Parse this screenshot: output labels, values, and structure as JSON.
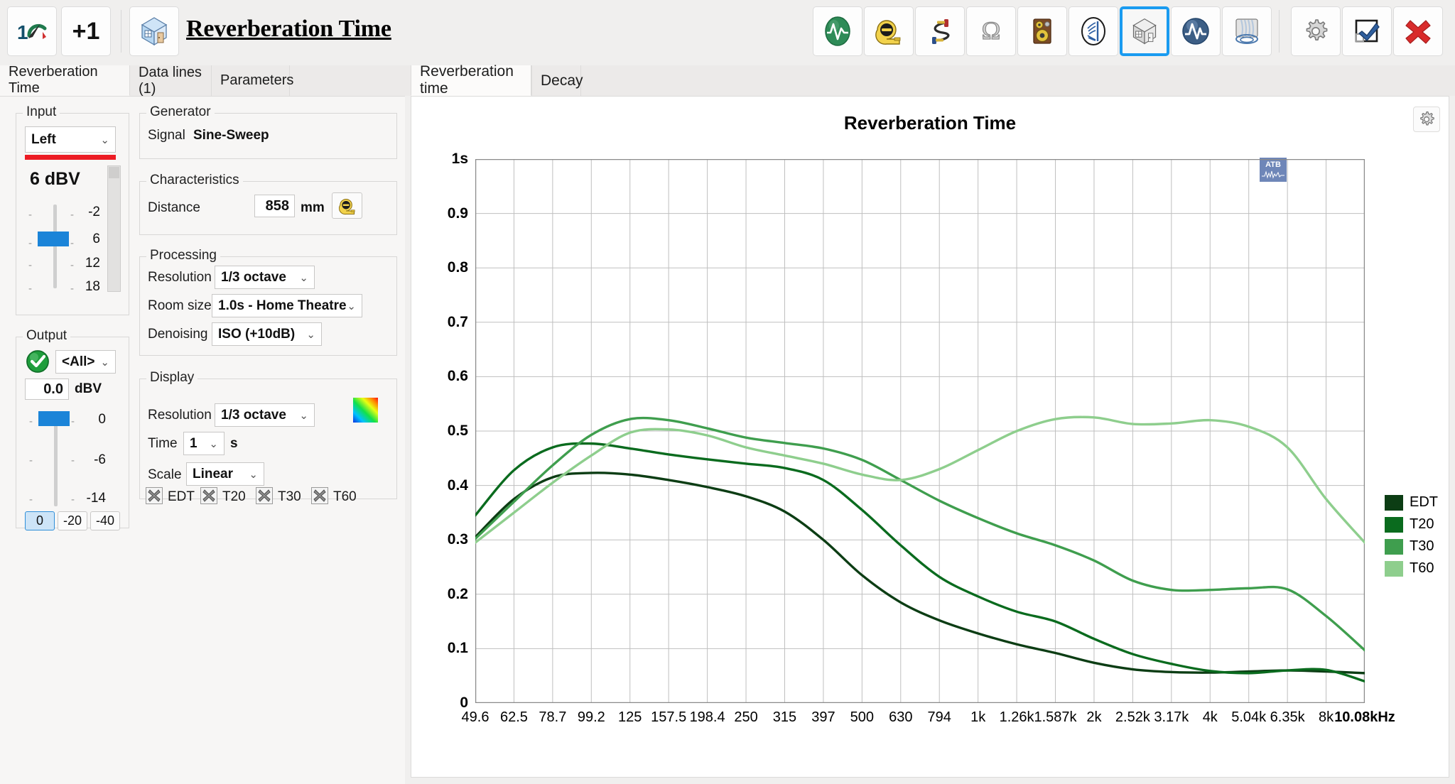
{
  "toolbar": {
    "left_buttons": [
      {
        "name": "gauge-one-button",
        "label": "1",
        "icon": "gauge-icon"
      },
      {
        "name": "plus-one-button",
        "label": "+1",
        "icon": "plus-one-icon"
      },
      {
        "name": "room-button",
        "label": "",
        "icon": "room-cube-icon"
      }
    ],
    "title": "Reverberation Time",
    "right_buttons": [
      {
        "name": "signal-button",
        "icon": "green-waveform-icon",
        "selected": false
      },
      {
        "name": "distance-button",
        "icon": "tape-measure-icon",
        "selected": false
      },
      {
        "name": "cable-button",
        "icon": "cable-icon",
        "selected": false
      },
      {
        "name": "impedance-button",
        "icon": "omega-icon",
        "selected": false
      },
      {
        "name": "speaker-button",
        "icon": "loudspeaker-icon",
        "selected": false
      },
      {
        "name": "microphone-button",
        "icon": "mic-pattern-icon",
        "selected": false
      },
      {
        "name": "room-acoustics-button",
        "icon": "room-cube-icon",
        "selected": true
      },
      {
        "name": "impulse-button",
        "icon": "blue-waveform-icon",
        "selected": false
      },
      {
        "name": "waterfall-button",
        "icon": "waterfall-icon",
        "selected": false
      },
      {
        "name": "settings-button",
        "icon": "gear-icon",
        "selected": false
      },
      {
        "name": "report-button",
        "icon": "report-check-icon",
        "selected": false
      },
      {
        "name": "close-button",
        "icon": "red-x-icon",
        "selected": false
      }
    ]
  },
  "left_panel": {
    "tabs": [
      {
        "label": "Reverberation Time",
        "active": true
      },
      {
        "label": "Data lines (1)",
        "active": false
      },
      {
        "label": "Parameters",
        "active": false
      }
    ],
    "input": {
      "title": "Input",
      "channel": "Left",
      "level_value": "6 dBV",
      "scale": [
        "-2",
        "6",
        "12",
        "18"
      ]
    },
    "output": {
      "title": "Output",
      "device": "<All>",
      "gain_value": "0.0",
      "gain_unit": "dBV",
      "scale": [
        "0",
        "-6",
        "-14"
      ],
      "presets": [
        {
          "label": "0",
          "active": true
        },
        {
          "label": "-20",
          "active": false
        },
        {
          "label": "-40",
          "active": false
        }
      ]
    },
    "generator": {
      "title": "Generator",
      "signal_label": "Signal",
      "signal_value": "Sine-Sweep"
    },
    "characteristics": {
      "title": "Characteristics",
      "distance_label": "Distance",
      "distance_value": "858",
      "distance_unit": "mm",
      "measure_button_icon": "tape-measure-icon"
    },
    "processing": {
      "title": "Processing",
      "resolution_label": "Resolution",
      "resolution_value": "1/3 octave",
      "roomsize_label": "Room size",
      "roomsize_value": "1.0s - Home Theatre",
      "denoising_label": "Denoising",
      "denoising_value": "ISO (+10dB)"
    },
    "display": {
      "title": "Display",
      "resolution_label": "Resolution",
      "resolution_value": "1/3 octave",
      "time_label": "Time",
      "time_value": "1",
      "time_unit": "s",
      "scale_label": "Scale",
      "scale_value": "Linear",
      "color_swatch_icon": "rainbow-gradient-icon",
      "curves": [
        {
          "label": "EDT",
          "checked": true
        },
        {
          "label": "T20",
          "checked": true
        },
        {
          "label": "T30",
          "checked": true
        },
        {
          "label": "T60",
          "checked": true
        }
      ]
    }
  },
  "right_panel": {
    "tabs": [
      {
        "label": "Reverberation time",
        "active": true
      },
      {
        "label": "Decay",
        "active": false
      }
    ],
    "gear_icon": "gear-icon",
    "watermark": "ATB"
  },
  "chart_data": {
    "type": "line",
    "title": "Reverberation Time",
    "xlabel": "",
    "ylabel": "1s",
    "ylim": [
      0,
      1
    ],
    "yticks": [
      "0",
      "0.1",
      "0.2",
      "0.3",
      "0.4",
      "0.5",
      "0.6",
      "0.7",
      "0.8",
      "0.9",
      "1s"
    ],
    "grid": true,
    "legend_position": "right",
    "x_unit_label": "10.08kHz",
    "categories": [
      "49.6",
      "62.5",
      "78.7",
      "99.2",
      "125",
      "157.5",
      "198.4",
      "250",
      "315",
      "397",
      "500",
      "630",
      "794",
      "1k",
      "1.26k",
      "1.587k",
      "2k",
      "2.52k",
      "3.17k",
      "4k",
      "5.04k",
      "6.35k",
      "8k",
      "10.08kHz"
    ],
    "series": [
      {
        "name": "EDT",
        "color": "#0c3d14",
        "values": [
          0.305,
          0.375,
          0.415,
          0.423,
          0.42,
          0.41,
          0.397,
          0.38,
          0.352,
          0.3,
          0.235,
          0.185,
          0.152,
          0.128,
          0.108,
          0.092,
          0.074,
          0.062,
          0.057,
          0.056,
          0.058,
          0.06,
          0.058,
          0.055
        ]
      },
      {
        "name": "T20",
        "color": "#0a6b1e",
        "values": [
          0.345,
          0.428,
          0.47,
          0.477,
          0.468,
          0.457,
          0.448,
          0.44,
          0.432,
          0.41,
          0.355,
          0.29,
          0.232,
          0.196,
          0.168,
          0.15,
          0.118,
          0.09,
          0.072,
          0.059,
          0.055,
          0.06,
          0.061,
          0.04
        ]
      },
      {
        "name": "T30",
        "color": "#3f9e4e",
        "values": [
          0.302,
          0.37,
          0.437,
          0.493,
          0.522,
          0.52,
          0.505,
          0.488,
          0.478,
          0.468,
          0.447,
          0.41,
          0.372,
          0.34,
          0.312,
          0.29,
          0.262,
          0.225,
          0.208,
          0.208,
          0.211,
          0.209,
          0.16,
          0.097
        ]
      },
      {
        "name": "T60",
        "color": "#8ece8d",
        "values": [
          0.295,
          0.35,
          0.405,
          0.455,
          0.497,
          0.503,
          0.492,
          0.47,
          0.455,
          0.44,
          0.42,
          0.41,
          0.43,
          0.465,
          0.5,
          0.522,
          0.525,
          0.513,
          0.514,
          0.52,
          0.508,
          0.47,
          0.375,
          0.295
        ]
      }
    ]
  }
}
